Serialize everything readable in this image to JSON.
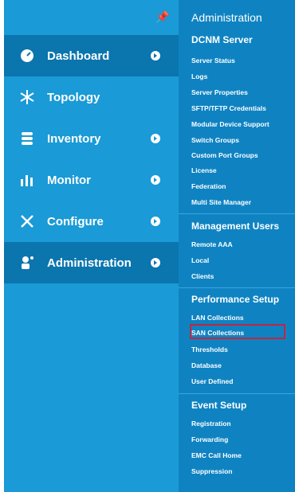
{
  "nav": {
    "items": [
      {
        "label": "Dashboard",
        "icon": "speedometer-icon"
      },
      {
        "label": "Topology",
        "icon": "topology-icon"
      },
      {
        "label": "Inventory",
        "icon": "database-icon"
      },
      {
        "label": "Monitor",
        "icon": "bar-chart-icon"
      },
      {
        "label": "Configure",
        "icon": "tools-icon"
      },
      {
        "label": "Administration",
        "icon": "admin-user-icon"
      }
    ]
  },
  "admin": {
    "title": "Administration",
    "sections": [
      {
        "heading": "DCNM Server",
        "items": [
          "Server Status",
          "Logs",
          "Server Properties",
          "SFTP/TFTP Credentials",
          "Modular Device Support",
          "Switch Groups",
          "Custom Port Groups",
          "License",
          "Federation",
          "Multi Site Manager"
        ]
      },
      {
        "heading": "Management Users",
        "items": [
          "Remote AAA",
          "Local",
          "Clients"
        ]
      },
      {
        "heading": "Performance Setup",
        "items": [
          "LAN Collections",
          "SAN Collections",
          "Thresholds",
          "Database",
          "User Defined"
        ]
      },
      {
        "heading": "Event Setup",
        "items": [
          "Registration",
          "Forwarding",
          "EMC Call Home",
          "Suppression"
        ]
      }
    ]
  },
  "colors": {
    "left_panel": "#1a9ad6",
    "right_panel": "#0f83c2",
    "active_item": "#0b75ad",
    "highlight_border": "#c1263f"
  }
}
